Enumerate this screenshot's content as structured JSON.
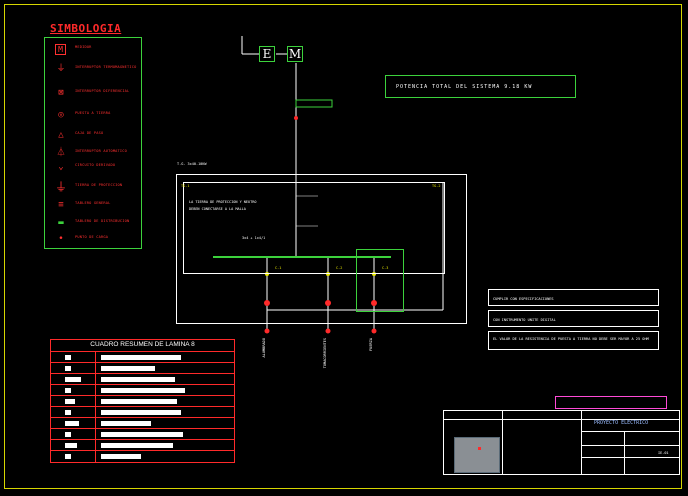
{
  "legend": {
    "title": "SIMBOLOGIA",
    "items": [
      {
        "symbol": "M",
        "label": "MEDIDOR"
      },
      {
        "symbol": "⏚",
        "label": "INTERRUPTOR TERMOMAGNETICO"
      },
      {
        "symbol": "⊠",
        "label": "INTERRUPTOR DIFERENCIAL"
      },
      {
        "symbol": "◎",
        "label": "PUESTA A TIERRA"
      },
      {
        "symbol": "△",
        "label": "CAJA DE PASO"
      },
      {
        "symbol": "⏃",
        "label": "INTERRUPTOR AUTOMATICO"
      },
      {
        "symbol": "⌄",
        "label": "CIRCUITO DERIVADO"
      },
      {
        "symbol": "⏚",
        "label": "TIERRA DE PROTECCION"
      },
      {
        "symbol": "≡",
        "label": "TABLERO GENERAL"
      },
      {
        "symbol": "▬",
        "label": "TABLERO DE DISTRIBUCION"
      },
      {
        "symbol": "•",
        "label": "PUNTO DE CARGA"
      }
    ]
  },
  "diagram": {
    "energy_label": "E",
    "meter_label": "M",
    "power_text": "POTENCIA TOTAL DEL SISTEMA 9.18 KW",
    "tg_label": "T.G. 3x40.10KW",
    "panel_left_label": "TG-1",
    "panel_right_label": "TG-2",
    "earth_text_1": "LA TIERRA DE PROTECCION Y NEUTRO",
    "earth_text_2": "DEBEN CONECTARSE A LA MALLA",
    "busbar_label": "3x4 + 1x4/1",
    "circuits": [
      {
        "name": "C-1",
        "label": "ALUMBRADO"
      },
      {
        "name": "C-2",
        "label": "TOMACORRIENTES"
      },
      {
        "name": "C-3",
        "label": "FUERZA"
      }
    ]
  },
  "notes": [
    "CUMPLIR CON ESPECIFICACIONES",
    "CON INSTRUMENTO UNITE DIGITAL",
    "EL VALOR DE LA RESISTENCIA DE PUESTA A TIERRA NO DEBE SER MAYOR A 25 OHM"
  ],
  "summary": {
    "title": "CUADRO RESUMEN DE LAMINA 8",
    "rows": 9
  },
  "title_block": {
    "project": "PROYECTO ELECTRICO",
    "sheet": "IE-01"
  }
}
